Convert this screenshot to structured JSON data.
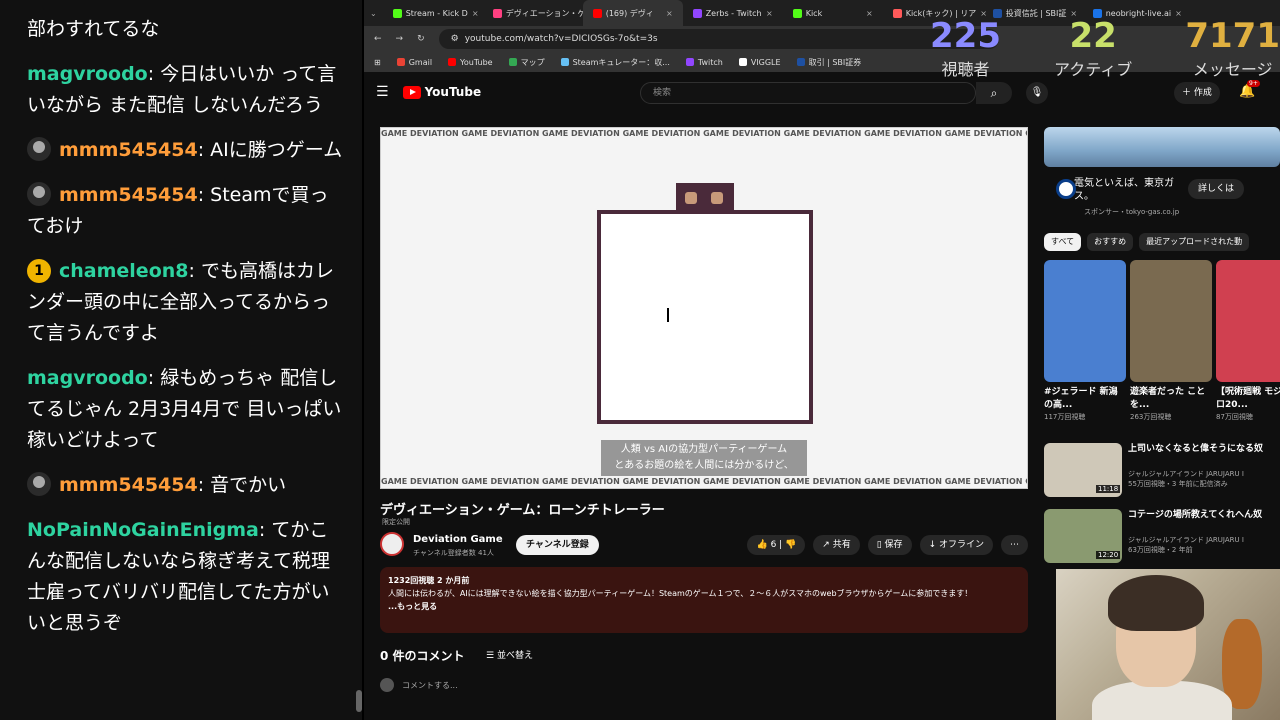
{
  "chat": {
    "messages": [
      {
        "user": "",
        "text": "部わすれてるな",
        "color": "#ffffff",
        "avatar": "none"
      },
      {
        "user": "magvroodo",
        "text": "今日はいいか って言いながら また配信 しないんだろう",
        "color": "#2ed3a0",
        "avatar": "none"
      },
      {
        "user": "mmm545454",
        "text": "AIに勝つゲーム",
        "color": "#ff9d3a",
        "avatar": "person"
      },
      {
        "user": "mmm545454",
        "text": "Steamで買っておけ",
        "color": "#ff9d3a",
        "avatar": "person"
      },
      {
        "user": "chameleon8",
        "text": "でも高橋はカレンダー頭の中に全部入ってるからって言うんですよ",
        "color": "#2ed3a0",
        "avatar": "badge",
        "badge": "1"
      },
      {
        "user": "magvroodo",
        "text": "緑もめっちゃ 配信してるじゃん 2月3月4月で 目いっぱい稼いどけよって",
        "color": "#2ed3a0",
        "avatar": "none"
      },
      {
        "user": "mmm545454",
        "text": "音でかい",
        "color": "#ff9d3a",
        "avatar": "person"
      },
      {
        "user": "NoPainNoGainEnigma",
        "text": "てかこんな配信しないなら稼ぎ考えて税理士雇ってバリバリ配信してた方がいいと思うぞ",
        "color": "#2ed3a0",
        "avatar": "none"
      }
    ]
  },
  "browser": {
    "tabs": [
      {
        "label": "Stream - Kick D",
        "color": "#53fc18"
      },
      {
        "label": "デヴィエーション・ゲ",
        "color": "#ff4081"
      },
      {
        "label": "(169) デヴィ",
        "color": "#ff0000",
        "active": true
      },
      {
        "label": "Zerbs - Twitch",
        "color": "#9146ff"
      },
      {
        "label": "Kick",
        "color": "#53fc18"
      },
      {
        "label": "Kick(キック) | リア",
        "color": "#ff5a5a"
      },
      {
        "label": "投資信託 | SBI証",
        "color": "#1e50a2"
      },
      {
        "label": "neobright-live.ai",
        "color": "#1a73e8"
      }
    ],
    "url": "youtube.com/watch?v=DICIOSGs-7o&t=3s",
    "bookmarks": [
      {
        "label": "Gmail",
        "color": "#ea4335"
      },
      {
        "label": "YouTube",
        "color": "#ff0000"
      },
      {
        "label": "マップ",
        "color": "#34a853"
      },
      {
        "label": "Steamキュレーター：収...",
        "color": "#66c0f4"
      },
      {
        "label": "Twitch",
        "color": "#9146ff"
      },
      {
        "label": "VIGGLE",
        "color": "#ffffff"
      },
      {
        "label": "取引 | SBI証券",
        "color": "#1e50a2"
      }
    ]
  },
  "stats": [
    {
      "value": "225",
      "label": "視聴者",
      "color": "#8a8aff"
    },
    {
      "value": "22",
      "label": "アクティブ",
      "color": "#c8e06a"
    },
    {
      "value": "7171",
      "label": "メッセージ",
      "color": "#e0b040"
    }
  ],
  "youtube": {
    "logo": "YouTube",
    "search_placeholder": "検索",
    "create_label": "作成",
    "notif_count": "9+",
    "player": {
      "marquee": "GAME DEVIATION GAME DEVIATION GAME DEVIATION GAME DEVIATION GAME DEVIATION GAME DEVIATION GAME DEVIATION GAME DEVIATION GAME DEVIATION GAME DEVIATION GAME DEV",
      "caption_line1": "人類 vs AIの協力型パーティーゲーム",
      "caption_line2": "とあるお題の絵を人間には分かるけど、"
    },
    "video": {
      "title": "デヴィエーション・ゲーム：ローンチトレーラー",
      "visibility": "限定公開",
      "channel": "Deviation Game",
      "subscribers": "チャンネル登録者数 41人",
      "subscribe_label": "チャンネル登録",
      "likes": "6",
      "share": "共有",
      "save": "保存",
      "offline": "オフライン",
      "views_date": "1232回視聴  2 か月前",
      "description": "人間には伝わるが、AIには理解できない絵を描く協力型パーティーゲーム！Steamのゲーム１つで、２～６人がスマホのwebブラウザからゲームに参加できます！",
      "more": "...もっと見る"
    },
    "comments": {
      "count": "0 件のコメント",
      "sort": "並べ替え",
      "placeholder": "コメントする..."
    },
    "ad": {
      "text": "電気といえば、東京ガス。",
      "sponsor": "スポンサー・tokyo-gas.co.jp",
      "button": "詳しくは"
    },
    "chips": [
      "すべて",
      "おすすめ",
      "最近アップロードされた動"
    ],
    "shorts": [
      {
        "title": "#ジェラード 新潟の高...",
        "views": "117万回視聴",
        "color": "#4a7fd0"
      },
      {
        "title": "遊楽者だった ことを...",
        "views": "263万回視聴",
        "color": "#7a6a50"
      },
      {
        "title": "【呪術廻戦 モジュロ20...",
        "views": "87万回視聴",
        "color": "#d04050"
      }
    ],
    "recommended": [
      {
        "title": "上司いなくなると偉そうになる奴",
        "channel": "ジャルジャルアイランド JARUJARU I",
        "meta": "55万回視聴・3 年前に配信済み",
        "duration": "11:18",
        "color": "#cfc8b8"
      },
      {
        "title": "コテージの場所教えてくれへん奴",
        "channel": "ジャルジャルアイランド JARUJARU I",
        "meta": "63万回視聴・2 年前",
        "duration": "12:20",
        "color": "#8a9a70"
      }
    ]
  }
}
